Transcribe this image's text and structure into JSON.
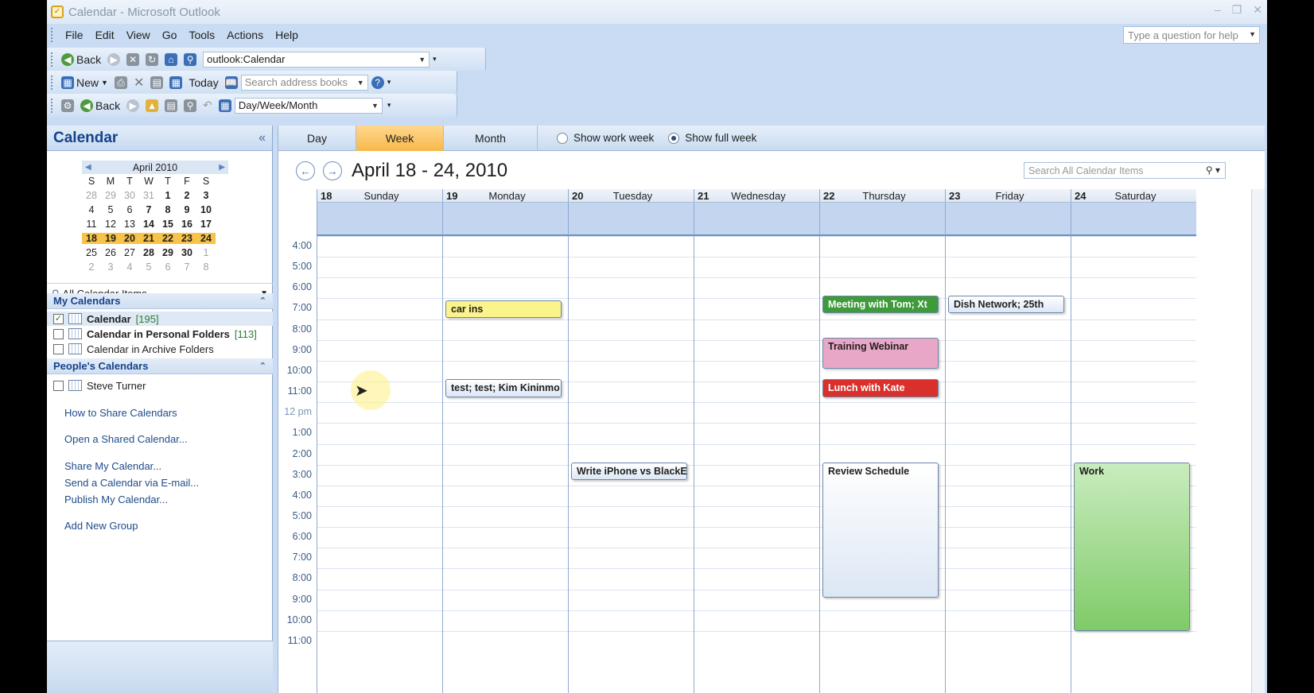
{
  "window": {
    "title": "Calendar - Microsoft Outlook"
  },
  "menu": [
    "File",
    "Edit",
    "View",
    "Go",
    "Tools",
    "Actions",
    "Help"
  ],
  "help_placeholder": "Type a question for help",
  "toolbar1": {
    "back": "Back",
    "address": "outlook:Calendar"
  },
  "toolbar2": {
    "new": "New",
    "today": "Today",
    "search_placeholder": "Search address books"
  },
  "toolbar3": {
    "back": "Back",
    "view": "Day/Week/Month"
  },
  "nav": {
    "title": "Calendar",
    "minical": {
      "month": "April 2010",
      "dow": [
        "S",
        "M",
        "T",
        "W",
        "T",
        "F",
        "S"
      ],
      "weeks": [
        [
          "28",
          "29",
          "30",
          "31",
          "1",
          "2",
          "3"
        ],
        [
          "4",
          "5",
          "6",
          "7",
          "8",
          "9",
          "10"
        ],
        [
          "11",
          "12",
          "13",
          "14",
          "15",
          "16",
          "17"
        ],
        [
          "18",
          "19",
          "20",
          "21",
          "22",
          "23",
          "24"
        ],
        [
          "25",
          "26",
          "27",
          "28",
          "29",
          "30",
          "1"
        ],
        [
          "2",
          "3",
          "4",
          "5",
          "6",
          "7",
          "8"
        ]
      ]
    },
    "all_items": "All Calendar Items",
    "my_calendars": {
      "header": "My Calendars",
      "items": [
        {
          "name": "Calendar",
          "count": "[195]",
          "checked": true
        },
        {
          "name": "Calendar in Personal Folders",
          "count": "[113]",
          "checked": false
        },
        {
          "name": "Calendar in Archive Folders",
          "count": "",
          "checked": false
        }
      ]
    },
    "peoples_calendars": {
      "header": "People's Calendars",
      "items": [
        {
          "name": "Steve Turner",
          "checked": false
        }
      ]
    },
    "links": [
      "How to Share Calendars",
      "Open a Shared Calendar...",
      "Share My Calendar...",
      "Send a Calendar via E-mail...",
      "Publish My Calendar...",
      "Add New Group"
    ]
  },
  "calendar": {
    "tabs": [
      "Day",
      "Week",
      "Month"
    ],
    "active_tab": "Week",
    "radio_work": "Show work week",
    "radio_full": "Show full week",
    "date_range": "April 18 - 24, 2010",
    "search_placeholder": "Search All Calendar Items",
    "days": [
      {
        "num": "18",
        "name": "Sunday"
      },
      {
        "num": "19",
        "name": "Monday"
      },
      {
        "num": "20",
        "name": "Tuesday"
      },
      {
        "num": "21",
        "name": "Wednesday"
      },
      {
        "num": "22",
        "name": "Thursday"
      },
      {
        "num": "23",
        "name": "Friday"
      },
      {
        "num": "24",
        "name": "Saturday"
      }
    ],
    "times": [
      "4:00",
      "5:00",
      "6:00",
      "7:00",
      "8:00",
      "9:00",
      "10:00",
      "11:00",
      "12 pm",
      "1:00",
      "2:00",
      "3:00",
      "4:00",
      "5:00",
      "6:00",
      "7:00",
      "8:00",
      "9:00",
      "10:00",
      "11:00"
    ],
    "events": [
      {
        "title": "car ins",
        "day": 1,
        "start_slot": 3.1,
        "span": 0.85,
        "color": "#fbf48b"
      },
      {
        "title": "test; test; Kim Kininmo",
        "day": 1,
        "start_slot": 6.9,
        "span": 0.85,
        "color": "#ffffff"
      },
      {
        "title": "Write iPhone vs BlackE",
        "day": 2,
        "start_slot": 10.9,
        "span": 0.85,
        "color": "#ffffff"
      },
      {
        "title": "Meeting with Tom; Xt",
        "day": 4,
        "start_slot": 2.85,
        "span": 0.85,
        "color": "#3f9a3a",
        "text_color": "#ffffff"
      },
      {
        "title": "Dish Network; 25th",
        "day": 5,
        "start_slot": 2.85,
        "span": 0.85,
        "color": "#ffffff"
      },
      {
        "title": "Training Webinar",
        "day": 4,
        "start_slot": 4.9,
        "span": 1.5,
        "color": "#e9a7c7"
      },
      {
        "title": "Lunch with Kate",
        "day": 4,
        "start_slot": 6.9,
        "span": 0.85,
        "color": "#d9302c",
        "text_color": "#ffffff"
      },
      {
        "title": "Review Schedule",
        "day": 4,
        "start_slot": 10.9,
        "span": 6.5,
        "color": "#ffffff"
      },
      {
        "title": "Work",
        "day": 6,
        "start_slot": 10.9,
        "span": 8.1,
        "color": "#90d47c"
      }
    ]
  }
}
